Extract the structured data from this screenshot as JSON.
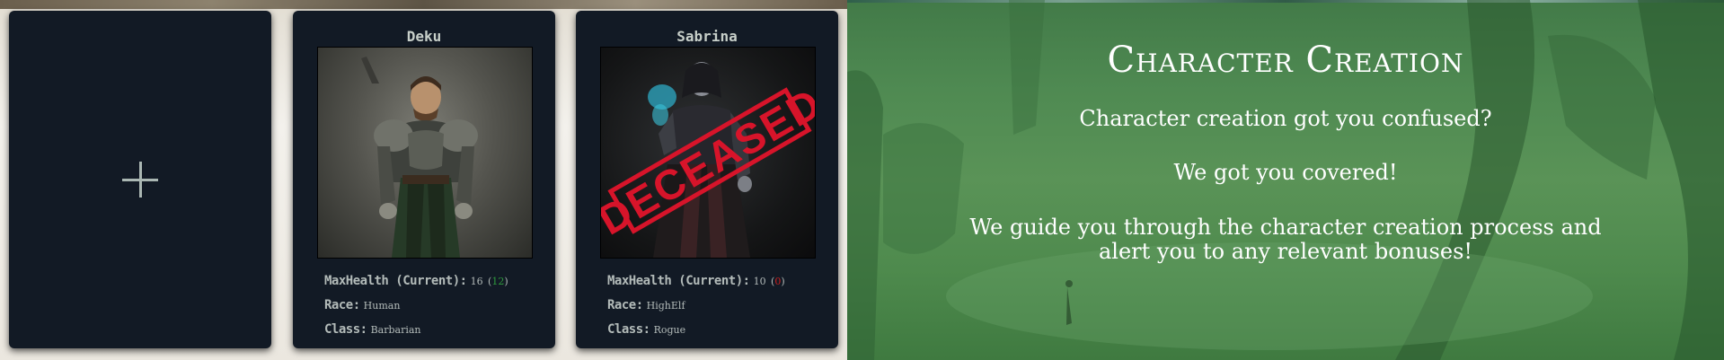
{
  "cards": {
    "add": {
      "icon": "plus-icon"
    },
    "deku": {
      "name": "Deku",
      "health_label": "MaxHealth (Current):",
      "health_max": "16",
      "health_open": "(",
      "health_current": "12",
      "health_close": ")",
      "race_label": "Race:",
      "race": "Human",
      "class_label": "Class:",
      "class": "Barbarian"
    },
    "sabrina": {
      "name": "Sabrina",
      "status": "DECEASED",
      "health_label": "MaxHealth (Current):",
      "health_max": "10",
      "health_open": "(",
      "health_current": "0",
      "health_close": ")",
      "race_label": "Race:",
      "race": "HighElf",
      "class_label": "Class:",
      "class": "Rogue"
    }
  },
  "hero": {
    "title": "Character Creation",
    "line1": "Character creation got you confused?",
    "line2": "We got you covered!",
    "line3": "We guide you through the character creation process and",
    "line4": "alert you to any relevant bonuses!"
  },
  "colors": {
    "card_bg": "#121a25",
    "health_current_ok": "#2e9a3d",
    "health_current_dead": "#c91e1e",
    "stamp_red": "#d7142a",
    "hero_green": "#4f8a52"
  }
}
